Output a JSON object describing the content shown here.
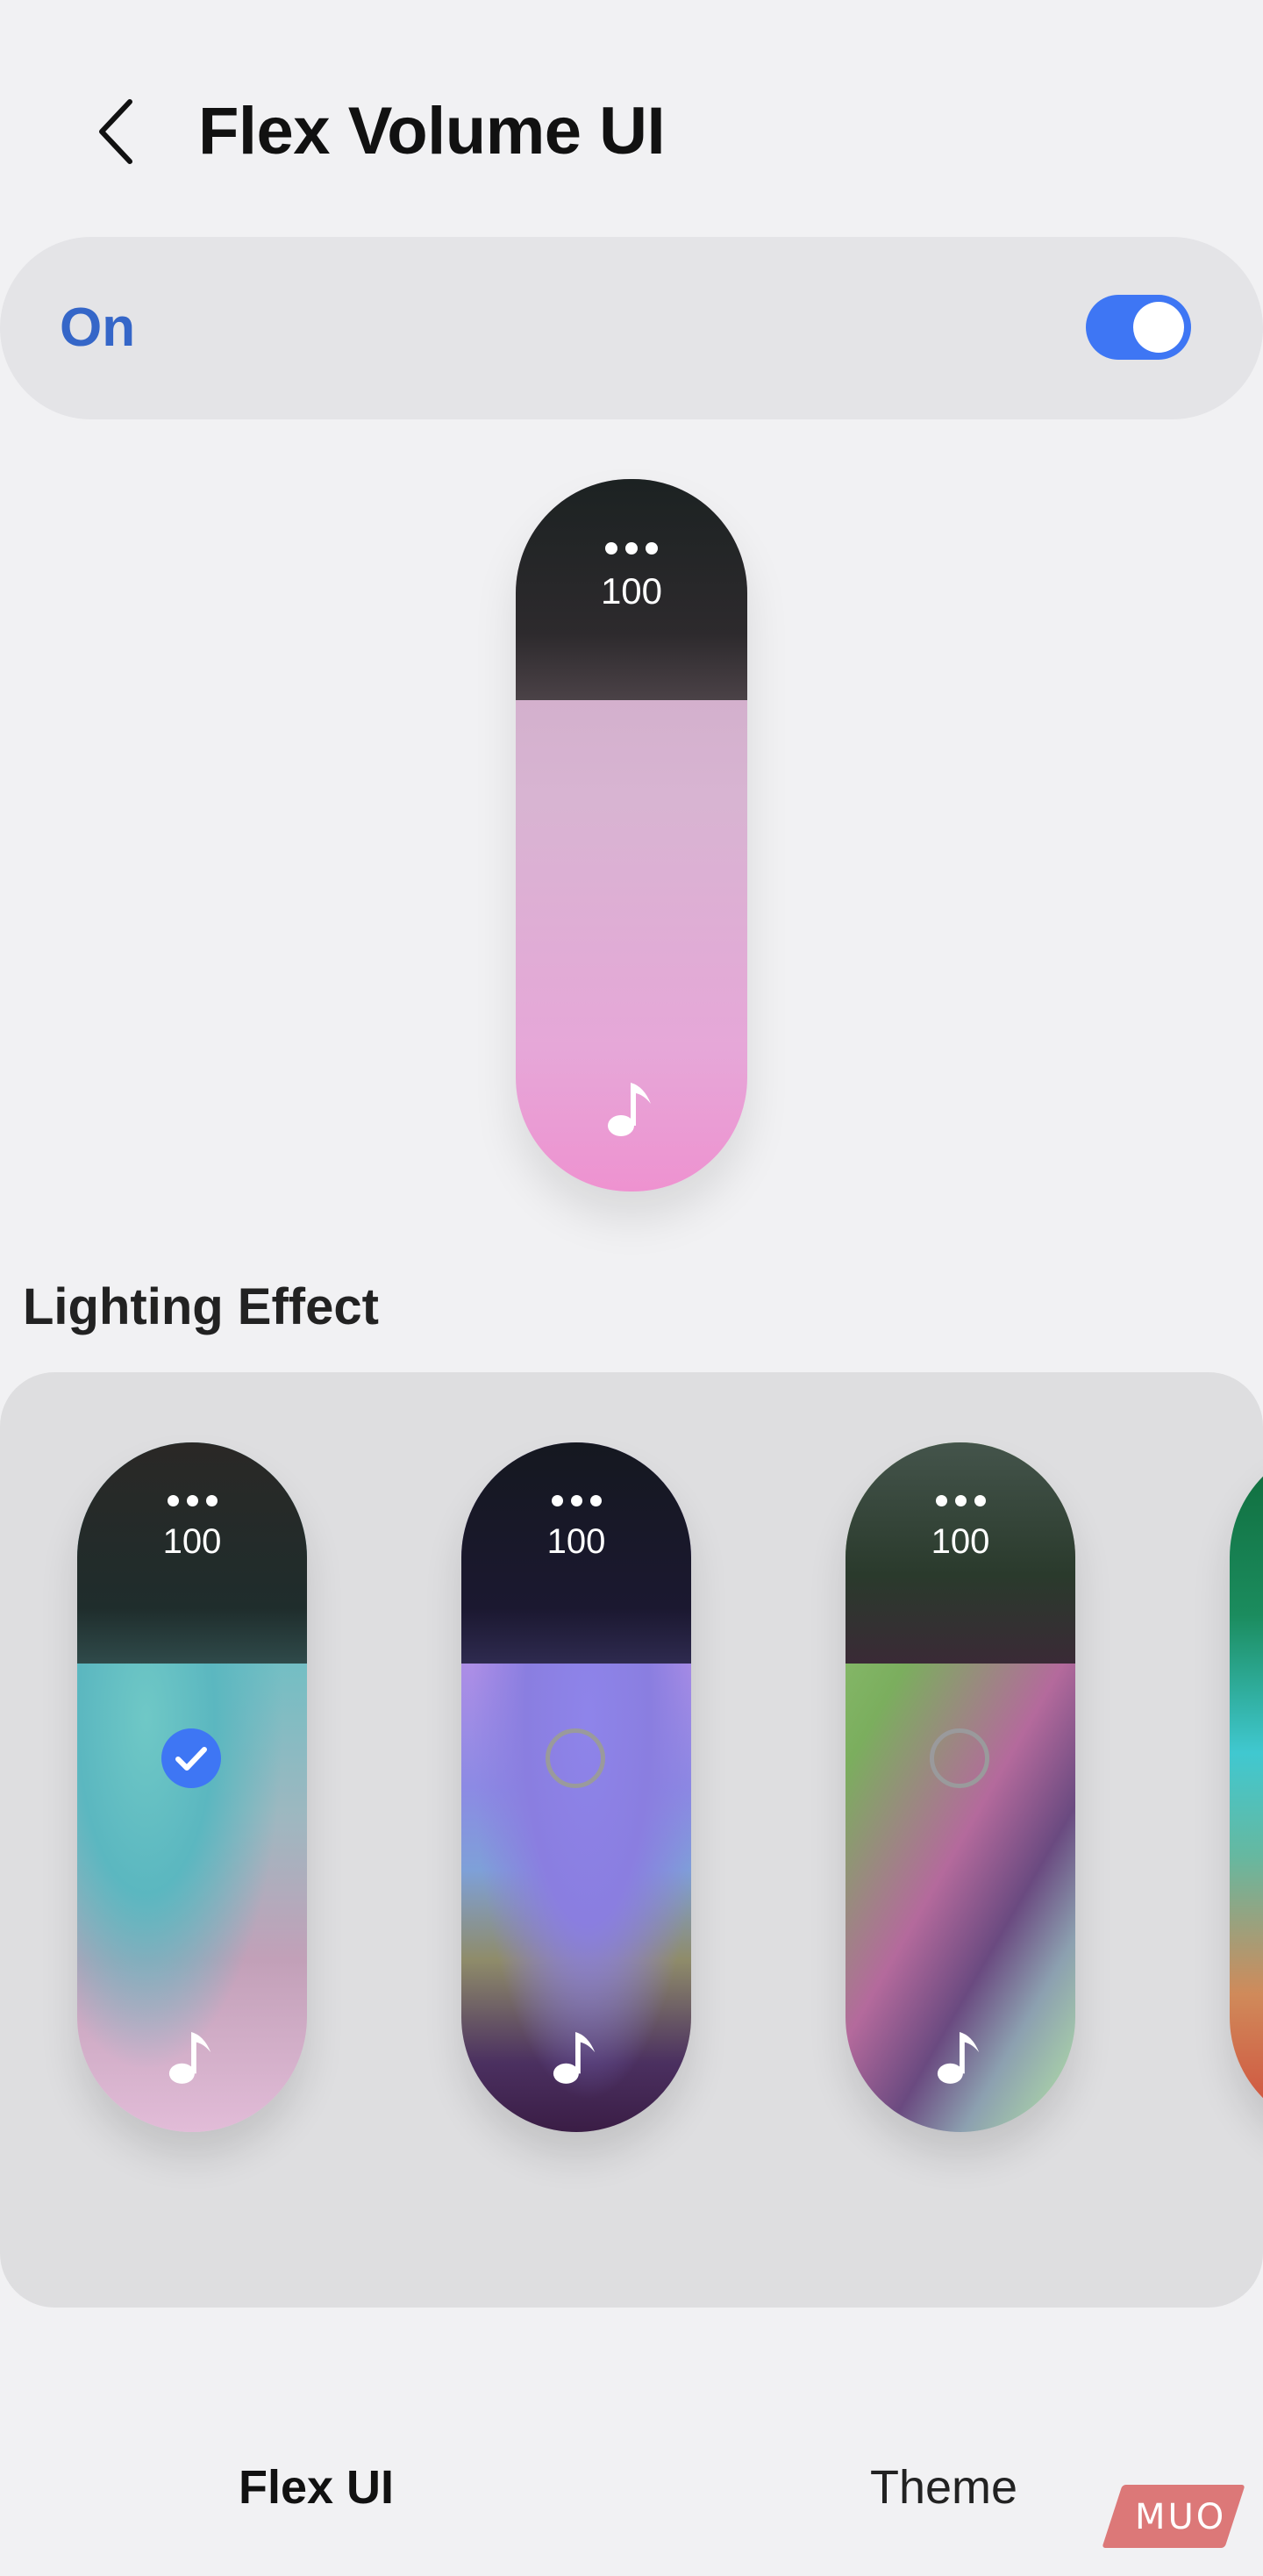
{
  "header": {
    "title": "Flex Volume UI",
    "back_icon": "chevron-left-icon"
  },
  "master_switch": {
    "label": "On",
    "state": "on",
    "accent_color": "#3e76f4"
  },
  "preview": {
    "value": "100",
    "more_icon": "more-horizontal-icon",
    "music_icon": "music-note-icon"
  },
  "lighting_effect": {
    "title": "Lighting Effect",
    "options": [
      {
        "value": "100",
        "selected": true
      },
      {
        "value": "100",
        "selected": false
      },
      {
        "value": "100",
        "selected": false
      }
    ]
  },
  "tabs": [
    {
      "label": "Flex UI",
      "active": true
    },
    {
      "label": "Theme",
      "active": false
    }
  ],
  "watermark": {
    "text": "MUO"
  }
}
